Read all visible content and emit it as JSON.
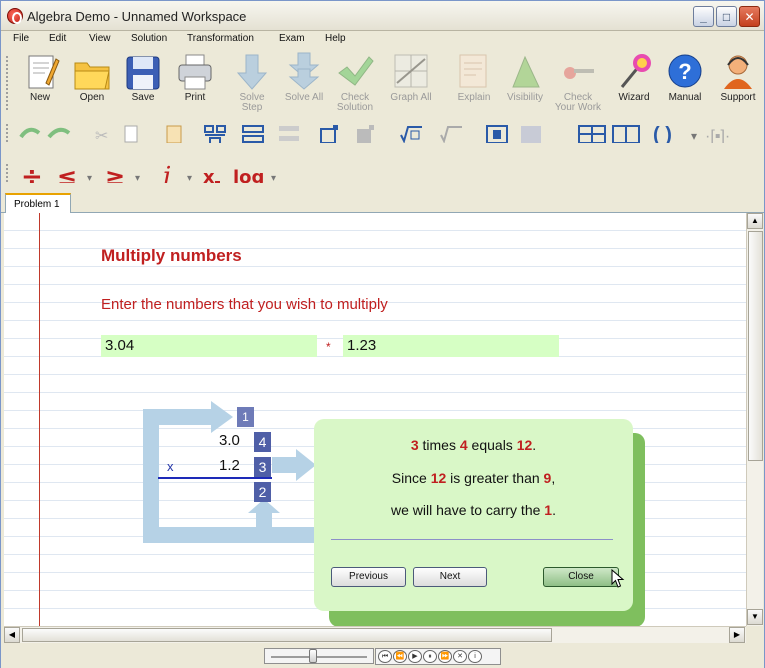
{
  "window": {
    "title": "Algebra Demo - Unnamed Workspace"
  },
  "menu": [
    "File",
    "Edit",
    "View",
    "Solution",
    "Transformation",
    "Exam",
    "Help"
  ],
  "toolbar": [
    {
      "label": "New",
      "icon": "new-document-icon"
    },
    {
      "label": "Open",
      "icon": "folder-icon"
    },
    {
      "label": "Save",
      "icon": "floppy-icon"
    },
    {
      "label": "Print",
      "icon": "printer-icon"
    },
    {
      "label": "Solve\nStep",
      "icon": "solve-step-icon"
    },
    {
      "label": "Solve All",
      "icon": "solve-all-icon"
    },
    {
      "label": "Check\nSolution",
      "icon": "check-solution-icon"
    },
    {
      "label": "Graph All",
      "icon": "graph-icon"
    },
    {
      "label": "Explain",
      "icon": "explain-icon"
    },
    {
      "label": "Visibility",
      "icon": "visibility-icon"
    },
    {
      "label": "Check\nYour Work",
      "icon": "check-work-icon"
    },
    {
      "label": "Wizard",
      "icon": "wizard-icon"
    },
    {
      "label": "Manual",
      "icon": "help-icon"
    },
    {
      "label": "Support",
      "icon": "support-icon"
    }
  ],
  "tabs": [
    "Problem 1"
  ],
  "problem": {
    "heading": "Multiply numbers",
    "prompt": "Enter the numbers that you wish to multiply",
    "first_number": "3.04",
    "operator": "*",
    "second_number": "1.23"
  },
  "multiplication": {
    "carry": "1",
    "row1_digits": "3.0",
    "row1_highlight": "4",
    "times_sign": "x",
    "row2_digits": "1.2",
    "row2_highlight": "3",
    "result_digit": "2"
  },
  "popup": {
    "line1": [
      "3",
      " times ",
      "4",
      " equals ",
      "12",
      "."
    ],
    "line2": [
      "Since ",
      "12",
      " is greater than ",
      "9",
      ","
    ],
    "line3": [
      "we will have to carry the ",
      "1",
      "."
    ],
    "previous": "Previous",
    "next": "Next",
    "close": "Close"
  },
  "colors": {
    "accent_red": "#c02020",
    "field_green": "#d6ffc4",
    "popup_green": "#d9f7c7",
    "digit_blue": "#4f5fa7"
  }
}
